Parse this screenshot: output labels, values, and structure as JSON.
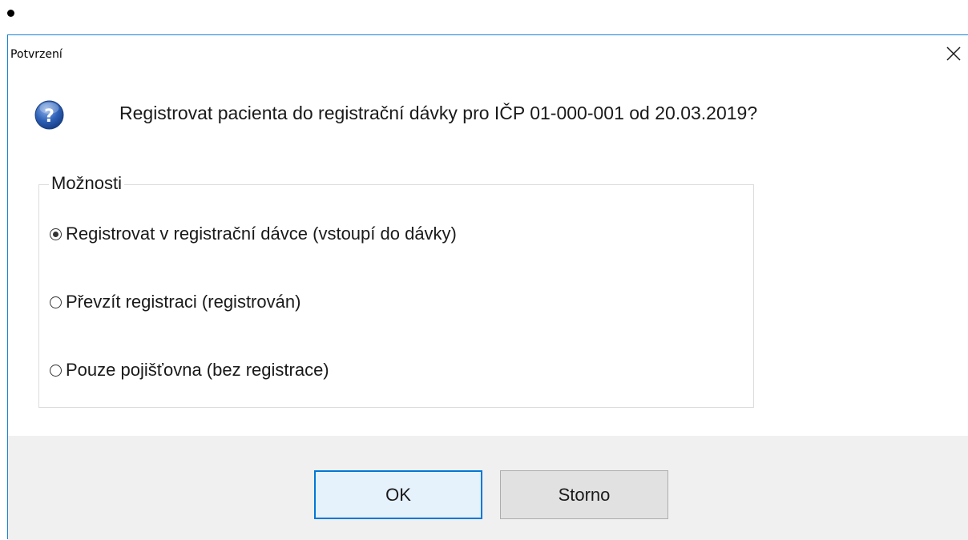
{
  "dialog": {
    "title": "Potvrzení",
    "icons": {
      "close": "close-icon",
      "question": "question-icon"
    },
    "message": "Registrovat pacienta do registrační dávky pro IČP 01-000-001 od 20.03.2019?",
    "options_group": {
      "label": "Možnosti",
      "options": [
        {
          "label": "Registrovat v registrační dávce (vstoupí do dávky)",
          "checked": true
        },
        {
          "label": "Převzít registraci (registrován)",
          "checked": false
        },
        {
          "label": "Pouze pojišťovna (bez registrace)",
          "checked": false
        }
      ]
    },
    "buttons": {
      "ok": "OK",
      "cancel": "Storno"
    },
    "colors": {
      "accent": "#0078d7",
      "window_border": "#1883d7",
      "footer_bg": "#f0f0f0"
    }
  }
}
